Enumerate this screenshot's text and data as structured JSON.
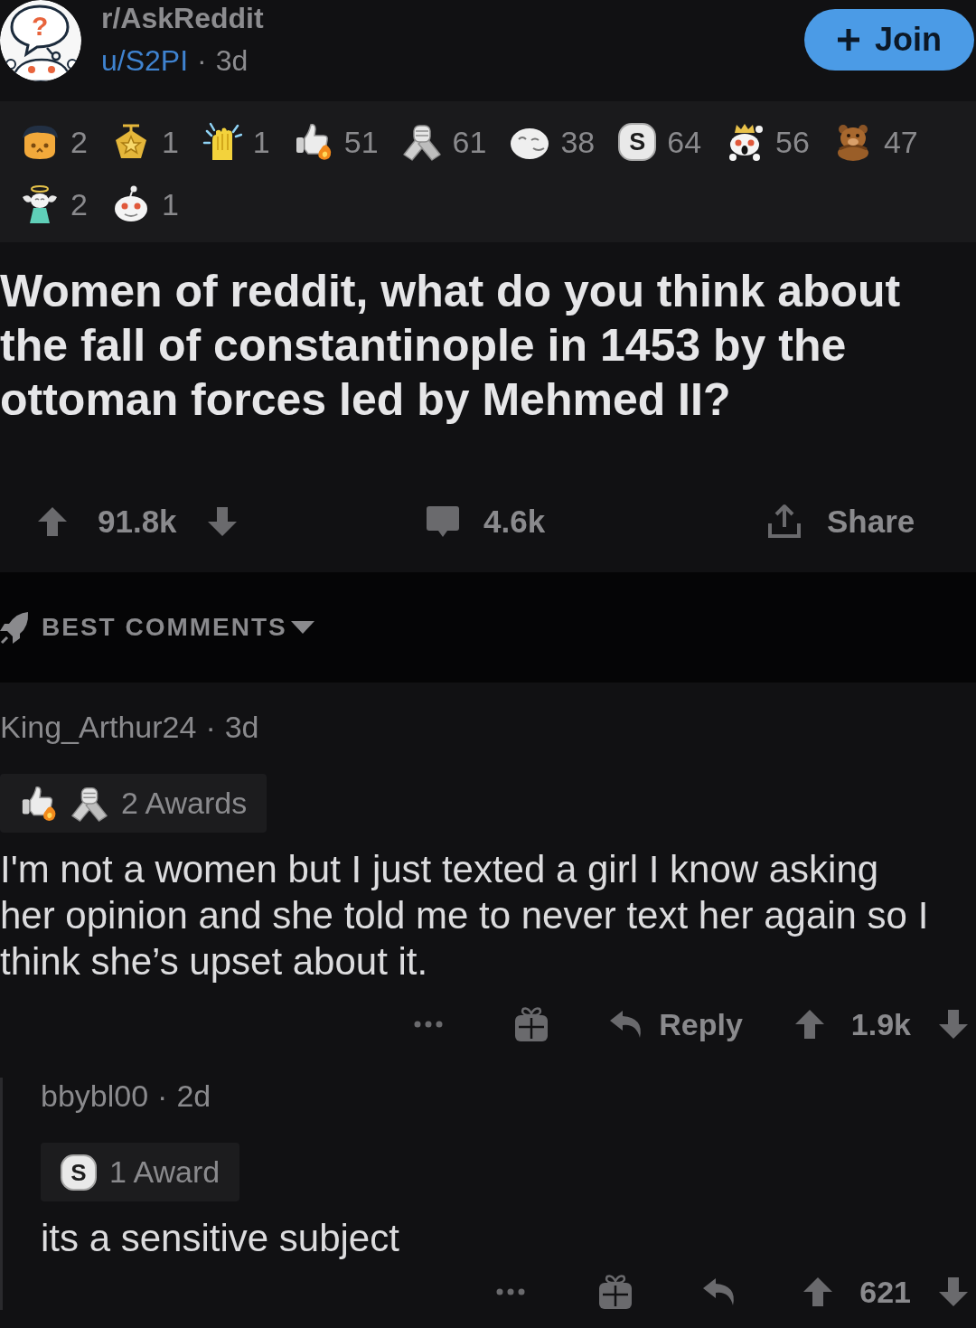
{
  "header": {
    "avatar_symbol": "?",
    "subreddit": "r/AskReddit",
    "author": "u/S2PI",
    "separator": "·",
    "age": "3d",
    "join_button": "Join"
  },
  "awards": [
    {
      "kind": "cat",
      "count": "2"
    },
    {
      "kind": "medal",
      "count": "1"
    },
    {
      "kind": "clap",
      "count": "1"
    },
    {
      "kind": "thumb",
      "count": "51"
    },
    {
      "kind": "handshake",
      "count": "61"
    },
    {
      "kind": "moon",
      "count": "38"
    },
    {
      "kind": "coin",
      "symbol": "S",
      "count": "64"
    },
    {
      "kind": "king",
      "count": "56"
    },
    {
      "kind": "bear",
      "count": "47"
    },
    {
      "kind": "angel",
      "count": "2"
    },
    {
      "kind": "snoo",
      "count": "1"
    }
  ],
  "title": "Women of reddit, what do you think about the fall of constantinople in 1453 by the ottoman forces led by Mehmed II?",
  "post_actions": {
    "score": "91.8k",
    "comments": "4.6k",
    "share": "Share"
  },
  "sort": {
    "label": "BEST COMMENTS"
  },
  "comments": [
    {
      "author": "King_Arthur24",
      "separator": "·",
      "age": "3d",
      "awards": [
        {
          "kind": "thumb"
        },
        {
          "kind": "handshake"
        }
      ],
      "awards_label": "2 Awards",
      "body": "I'm not a women but I just texted a girl I know asking her opinion and she told me to never text her again so I think she’s upset about it.",
      "reply": "Reply",
      "score": "1.9k",
      "children": [
        {
          "author": "bbybl00",
          "separator": "·",
          "age": "2d",
          "awards": [
            {
              "kind": "coin",
              "symbol": "S"
            }
          ],
          "awards_label": "1 Award",
          "body": "its a sensitive subject",
          "score": "621"
        }
      ]
    }
  ]
}
